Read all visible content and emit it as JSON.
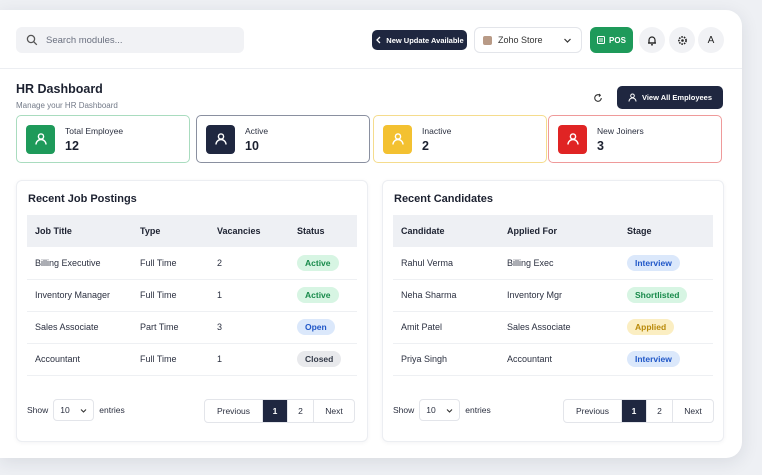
{
  "search": {
    "placeholder": "Search modules..."
  },
  "header": {
    "update_label": "New Update Available",
    "store_name": "Zoho Store",
    "pos_label": "POS",
    "avatar_initial": "A"
  },
  "page": {
    "title": "HR Dashboard",
    "subtitle": "Manage your HR Dashboard",
    "view_all_label": "View All Employees"
  },
  "stats": [
    {
      "label": "Total Employee",
      "value": "12",
      "color": "#1e9a5a",
      "border": "#a9dcbf",
      "icon": "user-check-icon"
    },
    {
      "label": "Active",
      "value": "10",
      "color": "#1f2740",
      "border": "#8a90a0",
      "icon": "user-icon"
    },
    {
      "label": "Inactive",
      "value": "2",
      "color": "#f3c131",
      "border": "#f5dc8d",
      "icon": "user-x-icon"
    },
    {
      "label": "New Joiners",
      "value": "3",
      "color": "#e02424",
      "border": "#ef9a9a",
      "icon": "user-plus-icon"
    }
  ],
  "jobs": {
    "title": "Recent Job Postings",
    "headers": [
      "Job Title",
      "Type",
      "Vacancies",
      "Status"
    ],
    "rows": [
      {
        "title": "Billing Executive",
        "type": "Full Time",
        "vacancies": "2",
        "status": "Active"
      },
      {
        "title": "Inventory Manager",
        "type": "Full Time",
        "vacancies": "1",
        "status": "Active"
      },
      {
        "title": "Sales Associate",
        "type": "Part Time",
        "vacancies": "3",
        "status": "Open"
      },
      {
        "title": "Accountant",
        "type": "Full Time",
        "vacancies": "1",
        "status": "Closed"
      }
    ],
    "show_label": "Show",
    "entries_value": "10",
    "entries_label": "entries",
    "pager": {
      "prev": "Previous",
      "pages": [
        "1",
        "2"
      ],
      "next": "Next"
    }
  },
  "candidates": {
    "title": "Recent Candidates",
    "headers": [
      "Candidate",
      "Applied For",
      "Stage"
    ],
    "rows": [
      {
        "name": "Rahul Verma",
        "applied": "Billing Exec",
        "stage": "Interview"
      },
      {
        "name": "Neha Sharma",
        "applied": "Inventory Mgr",
        "stage": "Shortlisted"
      },
      {
        "name": "Amit Patel",
        "applied": "Sales Associate",
        "stage": "Applied"
      },
      {
        "name": "Priya Singh",
        "applied": "Accountant",
        "stage": "Interview"
      }
    ],
    "show_label": "Show",
    "entries_value": "10",
    "entries_label": "entries",
    "pager": {
      "prev": "Previous",
      "pages": [
        "1",
        "2"
      ],
      "next": "Next"
    }
  }
}
